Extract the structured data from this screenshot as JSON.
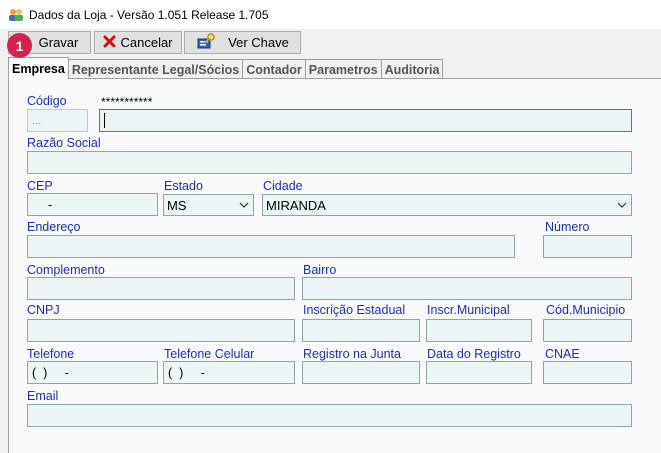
{
  "window": {
    "title": "Dados da Loja - Versão 1.051 Release 1.705"
  },
  "badge": "1",
  "toolbar": {
    "save_label": "Gravar",
    "cancel_label": "Cancelar",
    "key_label": "Ver Chave"
  },
  "tabs": [
    {
      "label": "Empresa"
    },
    {
      "label": "Representante Legal/Sócios"
    },
    {
      "label": "Contador"
    },
    {
      "label": "Parametros"
    },
    {
      "label": "Auditoria"
    }
  ],
  "form": {
    "codigo_label": "Código",
    "codigo_value": "...",
    "masked_key": "***********",
    "razao_social_label": "Razão Social",
    "cep_label": "CEP",
    "cep_value": "-",
    "estado_label": "Estado",
    "estado_value": "MS",
    "cidade_label": "Cidade",
    "cidade_value": "MIRANDA",
    "endereco_label": "Endereço",
    "numero_label": "Número",
    "complemento_label": "Complemento",
    "bairro_label": "Bairro",
    "cnpj_label": "CNPJ",
    "inscricao_estadual_label": "Inscrição Estadual",
    "inscr_municipal_label": "Inscr.Municipal",
    "cod_municipio_label": "Cód.Municipio",
    "telefone_label": "Telefone",
    "telefone_value": "(  )     -",
    "telefone_celular_label": "Telefone Celular",
    "telefone_celular_value": "(  )     -",
    "registro_junta_label": "Registro na Junta",
    "data_registro_label": "Data do Registro",
    "cnae_label": "CNAE",
    "email_label": "Email"
  },
  "colors": {
    "label_blue": "#1a2fb0",
    "field_bg": "#ecf5f5",
    "badge_red": "#d6214f"
  }
}
